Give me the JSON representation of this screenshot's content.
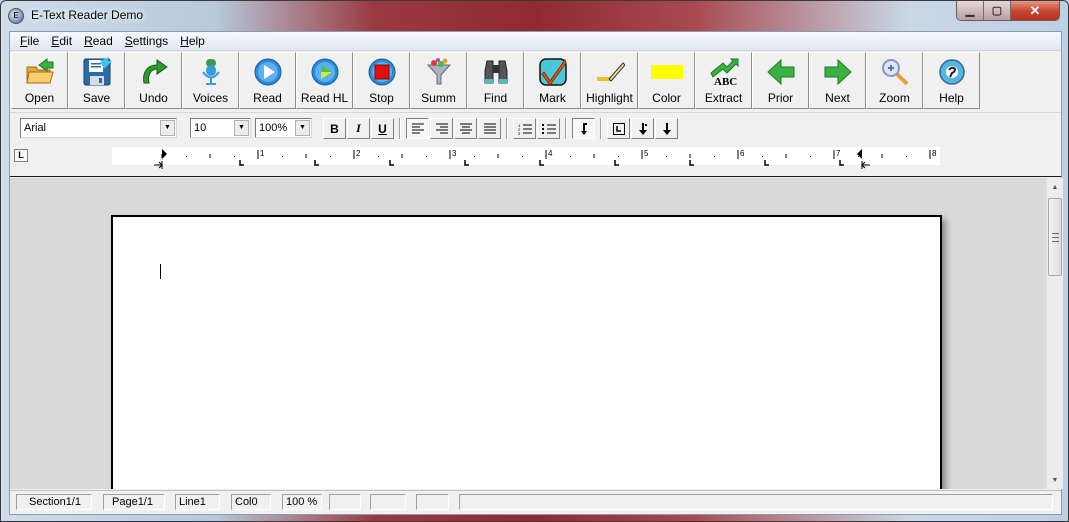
{
  "window": {
    "title": "E-Text Reader Demo",
    "app_icon": "etext-app-icon",
    "caption_buttons": [
      {
        "name": "minimize",
        "glyph": "▁"
      },
      {
        "name": "maximize",
        "glyph": "▢"
      },
      {
        "name": "close",
        "glyph": "✕"
      }
    ]
  },
  "menu": {
    "items": [
      {
        "label": "File",
        "accel": "F"
      },
      {
        "label": "Edit",
        "accel": "E"
      },
      {
        "label": "Read",
        "accel": "R"
      },
      {
        "label": "Settings",
        "accel": "S"
      },
      {
        "label": "Help",
        "accel": "H"
      }
    ]
  },
  "toolbar": {
    "buttons": [
      {
        "label": "Open",
        "icon": "open-folder-icon"
      },
      {
        "label": "Save",
        "icon": "floppy-save-icon"
      },
      {
        "label": "Undo",
        "icon": "undo-arrow-icon"
      },
      {
        "label": "Voices",
        "icon": "microphone-icon"
      },
      {
        "label": "Read",
        "icon": "play-icon"
      },
      {
        "label": "Read HL",
        "icon": "play-highlight-icon"
      },
      {
        "label": "Stop",
        "icon": "stop-icon"
      },
      {
        "label": "Summ",
        "icon": "funnel-icon"
      },
      {
        "label": "Find",
        "icon": "binoculars-icon"
      },
      {
        "label": "Mark",
        "icon": "checkmark-icon"
      },
      {
        "label": "Highlight",
        "icon": "highlighter-icon"
      },
      {
        "label": "Color",
        "icon": "color-swatch-icon"
      },
      {
        "label": "Extract",
        "icon": "extract-abc-icon"
      },
      {
        "label": "Prior",
        "icon": "arrow-left-icon"
      },
      {
        "label": "Next",
        "icon": "arrow-right-icon"
      },
      {
        "label": "Zoom",
        "icon": "magnifier-icon"
      },
      {
        "label": "Help",
        "icon": "help-lifebuoy-icon"
      }
    ],
    "highlight_color": "#ffff00"
  },
  "format": {
    "font_name": "Arial",
    "font_size": "10",
    "zoom": "100%",
    "bold": "B",
    "italic": "I",
    "underline": "U",
    "dropdown_glyph": "▼"
  },
  "ruler": {
    "tab_selector": "L",
    "numbers": [
      "1",
      "2",
      "3",
      "4",
      "5",
      "6",
      "7",
      "8"
    ]
  },
  "status": {
    "section": "Section1/1",
    "page": "Page1/1",
    "line": "Line1",
    "col": "Col0",
    "zoom": "100 %"
  },
  "scrollbar": {
    "up": "▲",
    "down": "▼"
  }
}
